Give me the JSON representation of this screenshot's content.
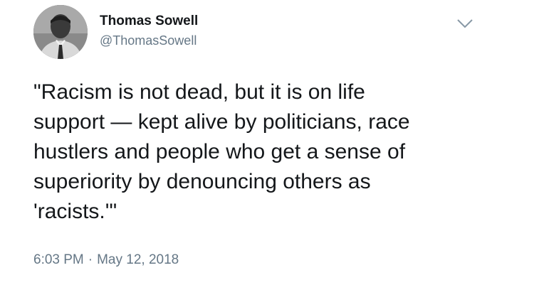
{
  "tweet": {
    "author": {
      "display_name": "Thomas Sowell",
      "handle": "@ThomasSowell",
      "avatar_icon": "profile-photo"
    },
    "menu_icon": "chevron-down-icon",
    "text": "\"Racism is not dead, but it is on life\nsupport — kept alive by politicians, race\nhustlers and people who get a sense of\nsuperiority by denouncing others as\n'racists.'\"",
    "time": "6:03 PM",
    "separator": "·",
    "date": "May 12, 2018"
  },
  "colors": {
    "text": "#14171a",
    "secondary": "#657786",
    "background": "#ffffff"
  }
}
